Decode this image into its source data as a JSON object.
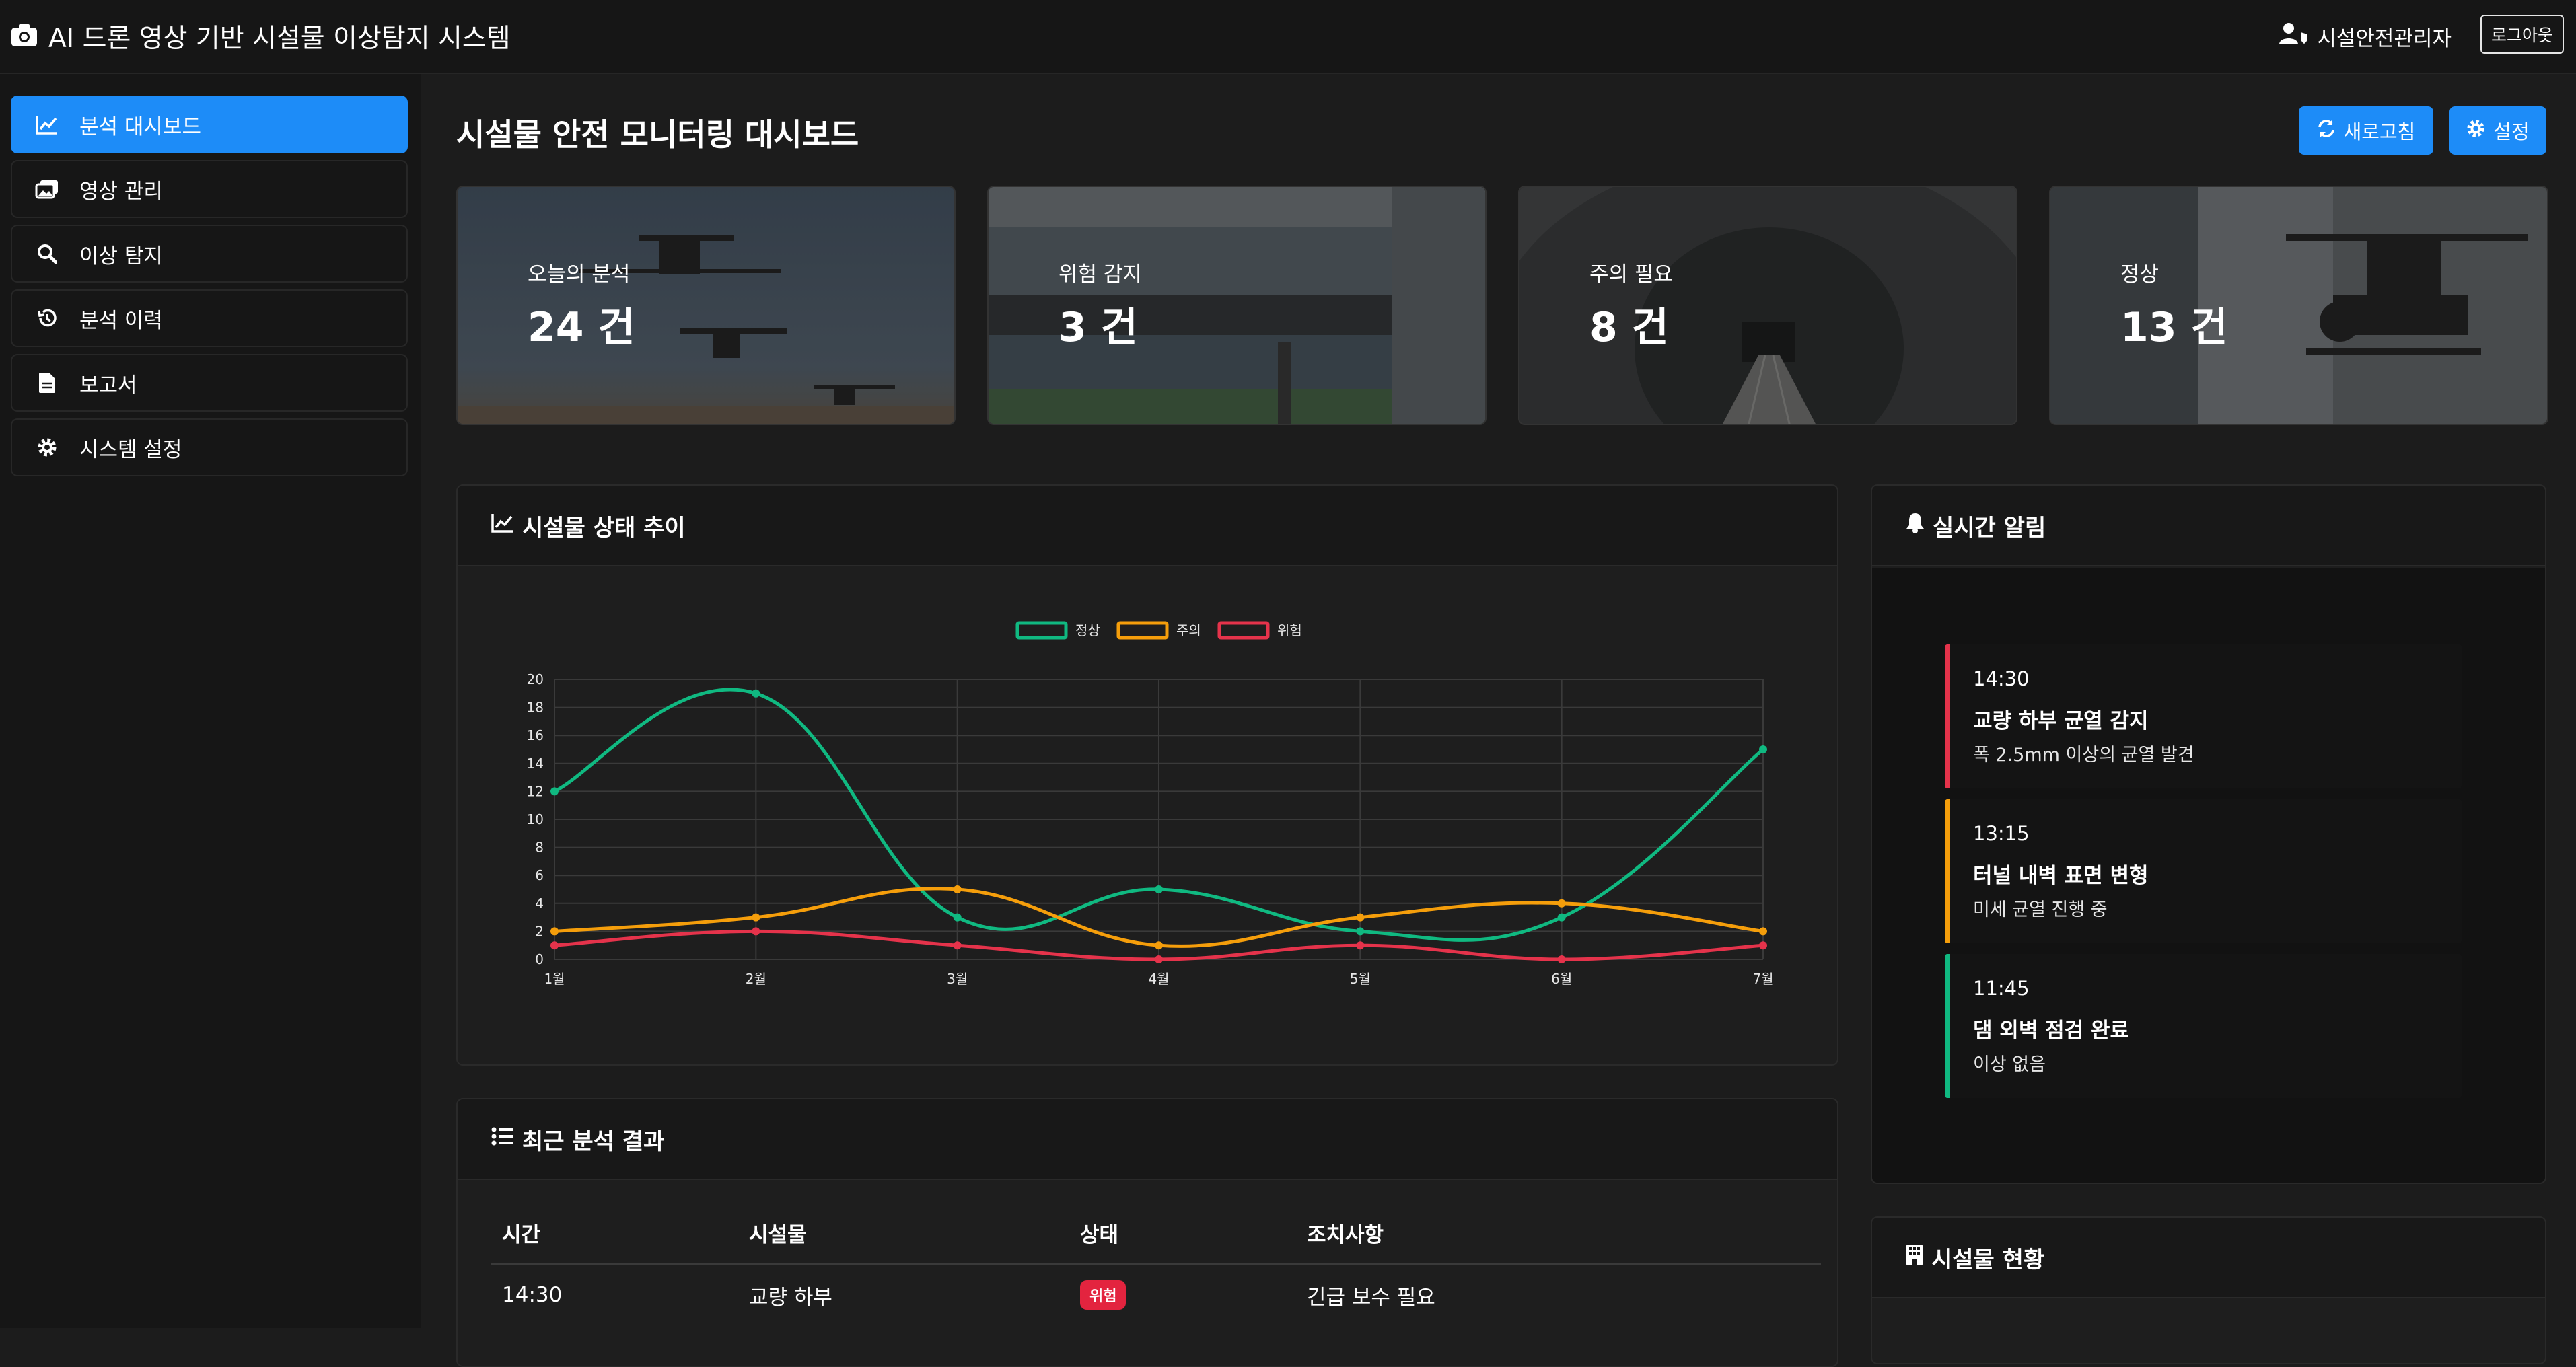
{
  "app": {
    "title": "AI 드론 영상 기반 시설물 이상탐지 시스템"
  },
  "user": {
    "name": "시설안전관리자",
    "logout_label": "로그아웃"
  },
  "sidebar": {
    "items": [
      {
        "label": "분석 대시보드",
        "icon": "chart-line-icon",
        "active": true
      },
      {
        "label": "영상 관리",
        "icon": "images-icon",
        "active": false
      },
      {
        "label": "이상 탐지",
        "icon": "search-icon",
        "active": false
      },
      {
        "label": "분석 이력",
        "icon": "history-icon",
        "active": false
      },
      {
        "label": "보고서",
        "icon": "file-icon",
        "active": false
      },
      {
        "label": "시스템 설정",
        "icon": "gear-icon",
        "active": false
      }
    ]
  },
  "main": {
    "title": "시설물 안전 모니터링 대시보드",
    "refresh_label": "새로고침",
    "settings_label": "설정"
  },
  "stats": [
    {
      "label": "오늘의 분석",
      "value": "24 건"
    },
    {
      "label": "위험 감지",
      "value": "3 건"
    },
    {
      "label": "주의 필요",
      "value": "8 건"
    },
    {
      "label": "정상",
      "value": "13 건"
    }
  ],
  "trend_card": {
    "title": "시설물 상태 추이"
  },
  "chart_data": {
    "type": "line",
    "x": [
      "1월",
      "2월",
      "3월",
      "4월",
      "5월",
      "6월",
      "7월"
    ],
    "series": [
      {
        "name": "정상",
        "values": [
          12,
          19,
          3,
          5,
          2,
          3,
          15
        ],
        "color": "#10b981"
      },
      {
        "name": "주의",
        "values": [
          2,
          3,
          5,
          1,
          3,
          4,
          2
        ],
        "color": "#f59e0b"
      },
      {
        "name": "위험",
        "values": [
          1,
          2,
          1,
          0,
          1,
          0,
          1
        ],
        "color": "#e5334b"
      }
    ],
    "ylim": [
      0,
      20
    ],
    "yticks": [
      "0",
      "2",
      "4",
      "6",
      "8",
      "10",
      "12",
      "14",
      "16",
      "18",
      "20"
    ],
    "grid": true,
    "legend": "top-center",
    "smooth": true
  },
  "recent_card": {
    "title": "최근 분석 결과",
    "columns": [
      "시간",
      "시설물",
      "상태",
      "조치사항"
    ],
    "rows": [
      {
        "time": "14:30",
        "facility": "교량 하부",
        "status": "위험",
        "action": "긴급 보수 필요"
      }
    ]
  },
  "alerts_card": {
    "title": "실시간 알림",
    "items": [
      {
        "time": "14:30",
        "title": "교량 하부 균열 감지",
        "desc": "폭 2.5mm 이상의 균열 발견",
        "color": "#e5334b"
      },
      {
        "time": "13:15",
        "title": "터널 내벽 표면 변형",
        "desc": "미세 균열 진행 중",
        "color": "#f59e0b"
      },
      {
        "time": "11:45",
        "title": "댐 외벽 점검 완료",
        "desc": "이상 없음",
        "color": "#10b981"
      }
    ]
  },
  "facility_card": {
    "title": "시설물 현황"
  }
}
